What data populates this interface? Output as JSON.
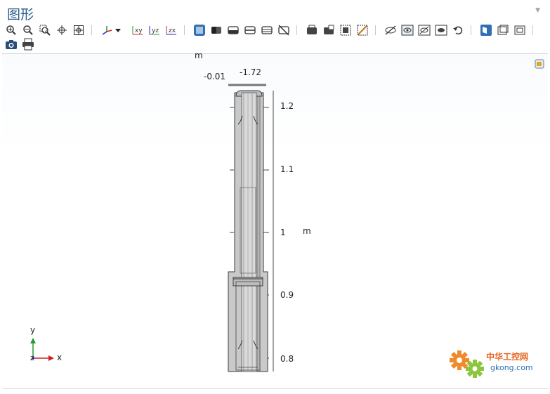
{
  "window": {
    "title": "图形"
  },
  "toolbar": {
    "row1_icons": [
      "zoom-in-icon",
      "zoom-out-icon",
      "zoom-box-icon",
      "center-icon",
      "zoom-extents-icon",
      "axis-view-icon",
      "dropdown-icon",
      "view-xy-icon",
      "view-yz-icon",
      "view-zx-icon",
      "select-all-icon",
      "select-domain-icon",
      "select-boundary-icon",
      "select-edge-icon",
      "select-point-icon",
      "clear-selection-icon",
      "show-selection-icon",
      "hide-selection-icon",
      "grid-icon",
      "transparency-icon",
      "hide-icon",
      "show-icon",
      "hidden-icon",
      "reset-hiding-icon",
      "undo-icon",
      "wireframe-icon",
      "render-icon",
      "copy-icon"
    ],
    "row2_icons": [
      "camera-icon",
      "print-icon"
    ],
    "labels": {
      "view_xy": "xy",
      "view_yz": "yz",
      "view_zx": "zx"
    }
  },
  "graphics": {
    "top_unit": "m",
    "x_tick_left": "-0.01",
    "x_tick_right": "-1.72",
    "y_ticks": [
      "1.2",
      "1.1",
      "1",
      "0.9",
      "0.8"
    ],
    "y_unit": "m",
    "triad": {
      "y": "y",
      "z": "z",
      "x": "x"
    }
  },
  "watermark": {
    "line1": "中华工控网",
    "line2": "gkong.com"
  },
  "colors": {
    "title": "#2b5d8c",
    "accent": "#1e77c8",
    "geometry_fill": "#c9c9c9",
    "geometry_stroke": "#3a3a3a"
  }
}
